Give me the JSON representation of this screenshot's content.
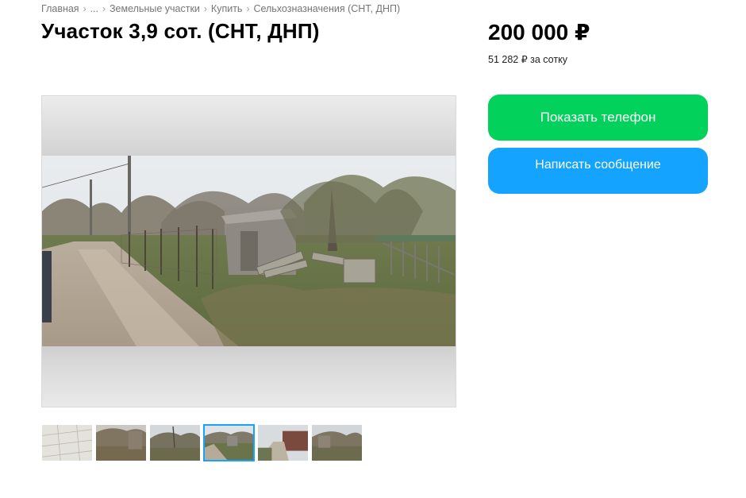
{
  "breadcrumb": [
    {
      "label": "Главная"
    },
    {
      "label": "..."
    },
    {
      "label": "Земельные участки"
    },
    {
      "label": "Купить"
    },
    {
      "label": "Сельхозназначения (СНТ, ДНП)"
    }
  ],
  "breadcrumb_separator": "›",
  "listing": {
    "title": "Участок 3,9 сот. (СНТ, ДНП)",
    "price": "200 000 ₽",
    "price_per": "51 282 ₽ за сотку"
  },
  "actions": {
    "show_phone": "Показать телефон",
    "write_message": "Написать сообщение"
  },
  "colors": {
    "phone_button": "#02d15c",
    "message_button": "#14a4ff",
    "breadcrumb_text": "#767676",
    "active_thumb_border": "#14a4ff"
  },
  "gallery": {
    "active_index": 3,
    "thumbnail_count": 6
  }
}
